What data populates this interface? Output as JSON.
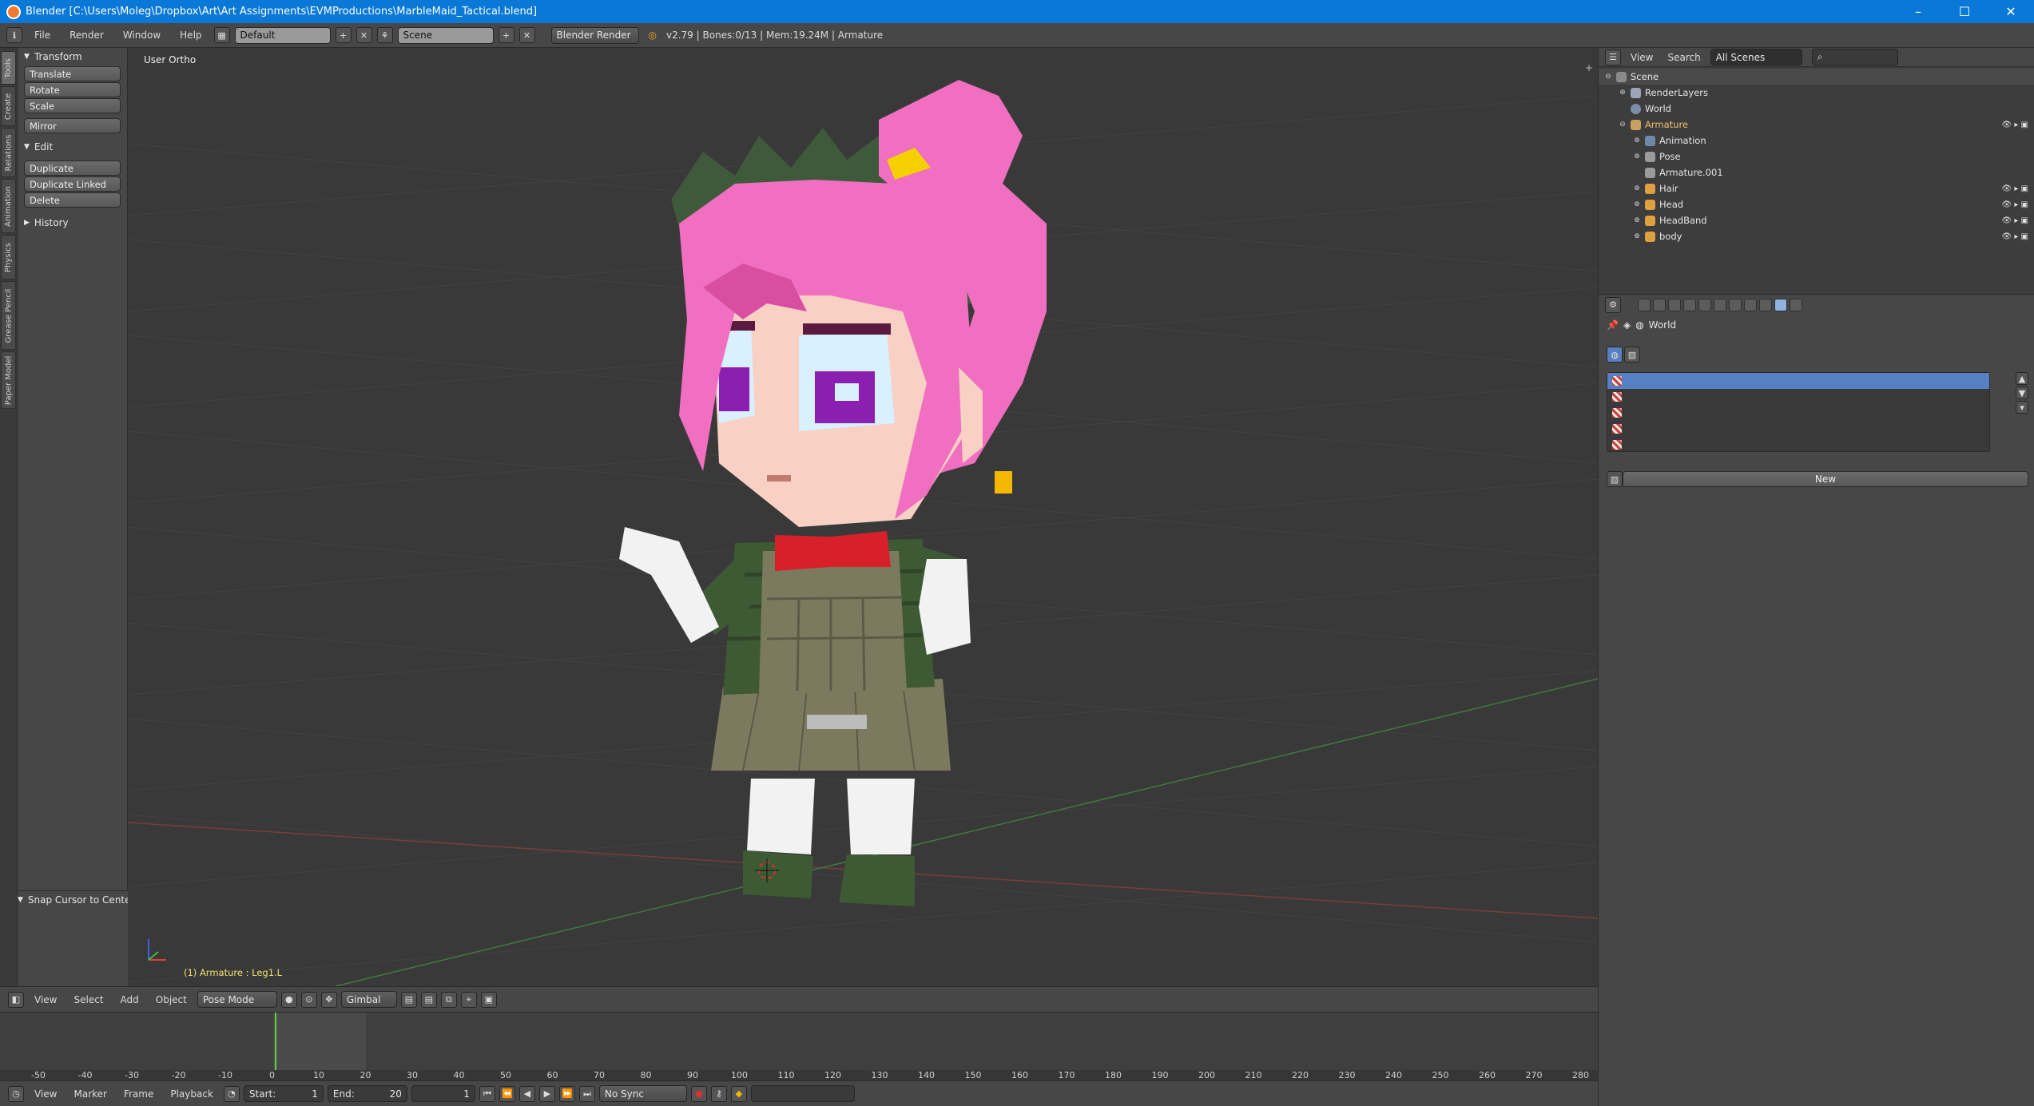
{
  "window": {
    "title": "Blender [C:\\Users\\Moleg\\Dropbox\\Art\\Art Assignments\\EVMProductions\\MarbleMaid_Tactical.blend]",
    "minimize": "–",
    "maximize": "☐",
    "close": "✕"
  },
  "info_header": {
    "menus": [
      "File",
      "Render",
      "Window",
      "Help"
    ],
    "layout": "Default",
    "scene": "Scene",
    "engine": "Blender Render",
    "stats": "v2.79 | Bones:0/13 | Mem:19.24M | Armature"
  },
  "tool_tabs": [
    "Tools",
    "Create",
    "Relations",
    "Animation",
    "Physics",
    "Grease Pencil",
    "Paper Model"
  ],
  "toolshelf": {
    "transform_title": "Transform",
    "translate": "Translate",
    "rotate": "Rotate",
    "scale": "Scale",
    "mirror": "Mirror",
    "edit_title": "Edit",
    "duplicate": "Duplicate",
    "duplicate_linked": "Duplicate Linked",
    "delete": "Delete",
    "history_title": "History",
    "snap_title": "Snap Cursor to Center"
  },
  "viewport": {
    "view_label": "User Ortho",
    "status": "(1) Armature : Leg1.L",
    "colors": {
      "hair": "#f06fc0",
      "hair_dark": "#d84fa2",
      "crown": "#3f5a3a",
      "skin": "#f8d0c4",
      "uniform": "#3d5a34",
      "vest": "#7c7a5e",
      "bow": "#d8202a",
      "white": "#f2f2f2"
    }
  },
  "viewport_header": {
    "menus": [
      "View",
      "Select",
      "Add",
      "Object"
    ],
    "mode": "Pose Mode",
    "orientation": "Gimbal"
  },
  "timeline": {
    "ticks": [
      "-50",
      "-40",
      "-30",
      "-20",
      "-10",
      "0",
      "10",
      "20",
      "30",
      "40",
      "50",
      "60",
      "70",
      "80",
      "90",
      "100",
      "110",
      "120",
      "130",
      "140",
      "150",
      "160",
      "170",
      "180",
      "190",
      "200",
      "210",
      "220",
      "230",
      "240",
      "250",
      "260",
      "270",
      "280"
    ],
    "current_frame_value": 0
  },
  "timeline_header": {
    "menus": [
      "View",
      "Marker",
      "Frame",
      "Playback"
    ],
    "start_label": "Start:",
    "start_value": "1",
    "end_label": "End:",
    "end_value": "20",
    "current": "1",
    "sync": "No Sync"
  },
  "outliner": {
    "menus": [
      "View",
      "Search"
    ],
    "filter": "All Scenes",
    "rows": [
      "Scene",
      "RenderLayers",
      "World",
      "Armature",
      "Animation",
      "Pose",
      "Armature.001",
      "Hair",
      "Head",
      "HeadBand",
      "body"
    ]
  },
  "properties": {
    "crumb": "World",
    "new_label": "New"
  }
}
